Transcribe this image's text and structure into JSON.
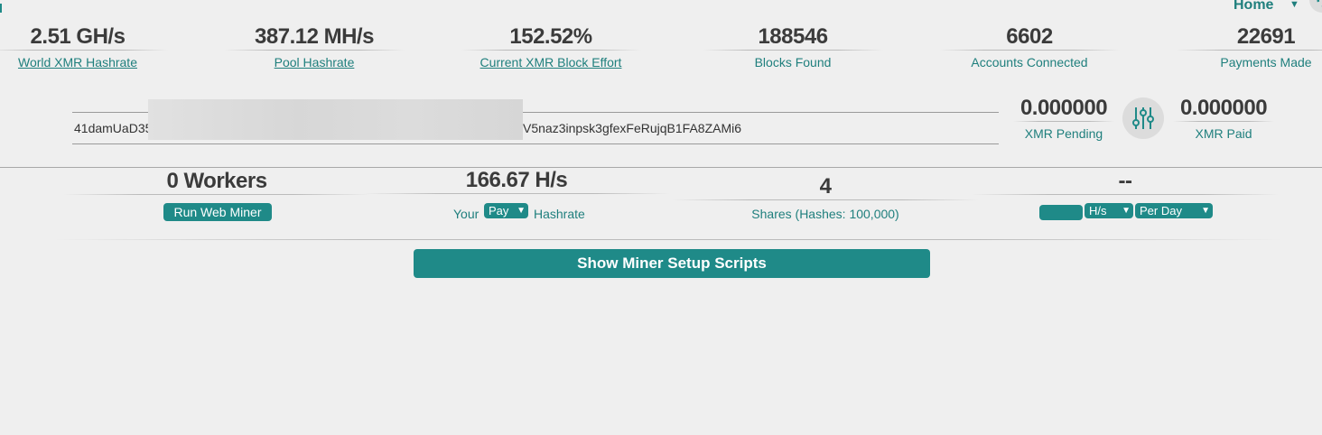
{
  "nav": {
    "home_label": "Home"
  },
  "stats": [
    {
      "value": "2.51 GH/s",
      "label": "World XMR Hashrate",
      "link": true
    },
    {
      "value": "387.12 MH/s",
      "label": "Pool Hashrate",
      "link": true
    },
    {
      "value": "152.52%",
      "label": "Current XMR Block Effort",
      "link": true
    },
    {
      "value": "188546",
      "label": "Blocks Found",
      "link": false
    },
    {
      "value": "6602",
      "label": "Accounts Connected",
      "link": false
    },
    {
      "value": "22691",
      "label": "Payments Made",
      "link": false
    }
  ],
  "address": {
    "prefix": "41damUaD35",
    "suffix": "V5naz3inpsk3gfexFeRujqB1FA8ZAMi6"
  },
  "balances": {
    "pending_value": "0.000000",
    "pending_label": "XMR Pending",
    "paid_value": "0.000000",
    "paid_label": "XMR Paid"
  },
  "miner": {
    "workers": "0 Workers",
    "web_miner_button": "Run Web Miner",
    "hashrate": "166.67 H/s",
    "your_label": "Your",
    "period_select": "Pay",
    "hashrate_label": "Hashrate",
    "shares": "4",
    "shares_label": "Shares (Hashes: 100,000)",
    "calc_value": "--",
    "unit_select": "H/s",
    "per_select": "Per Day"
  },
  "setup_button": "Show Miner Setup Scripts",
  "colors": {
    "accent": "#1f8a88",
    "text_dark": "#3b3b3b",
    "background": "#efefef"
  }
}
